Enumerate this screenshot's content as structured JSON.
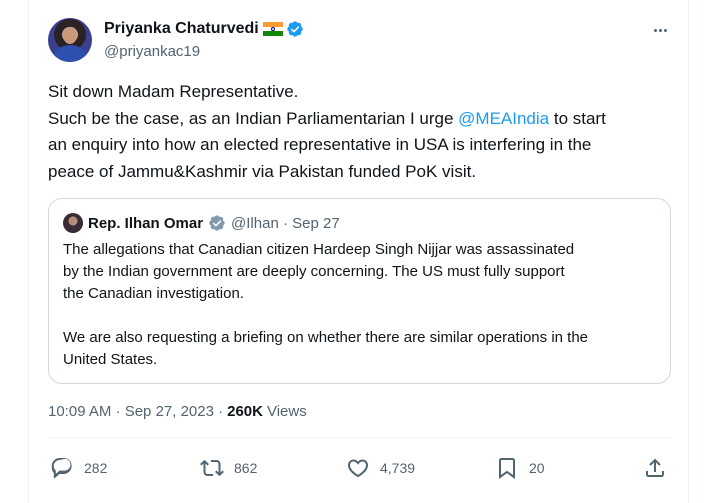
{
  "tweet": {
    "author_name": "Priyanka Chaturvedi",
    "author_handle": "@priyankac19",
    "lines": [
      "Sit down Madam Representative.",
      "Such be the case, as an Indian Parliamentarian I urge ",
      " to start",
      "an enquiry into how an elected representative in USA is interfering in the",
      "peace of Jammu&Kashmir via Pakistan funded PoK visit."
    ],
    "mention": "@MEAIndia"
  },
  "quote": {
    "author_name": "Rep. Ilhan Omar",
    "handle_date": "@Ilhan · Sep 27",
    "paragraph1": [
      "The allegations that Canadian citizen Hardeep Singh Nijjar was assassinated",
      "by the Indian government are deeply concerning. The US must fully support",
      "the Canadian investigation."
    ],
    "paragraph2": [
      "We are also requesting a briefing on whether there are similar operations in the",
      "United States."
    ]
  },
  "meta": {
    "timestamp": "10:09 AM · Sep 27, 2023 · ",
    "views_count": "260K",
    "views_label": "Views"
  },
  "actions": {
    "replies": "282",
    "reposts": "862",
    "likes": "4,739",
    "bookmarks": "20"
  },
  "colors": {
    "accent": "#1d9bf0",
    "text": "#0f1419",
    "muted": "#536471"
  },
  "icons": [
    "verified-badge-icon",
    "india-flag-icon",
    "more-icon",
    "reply-icon",
    "repost-icon",
    "like-icon",
    "bookmark-icon",
    "share-icon"
  ]
}
